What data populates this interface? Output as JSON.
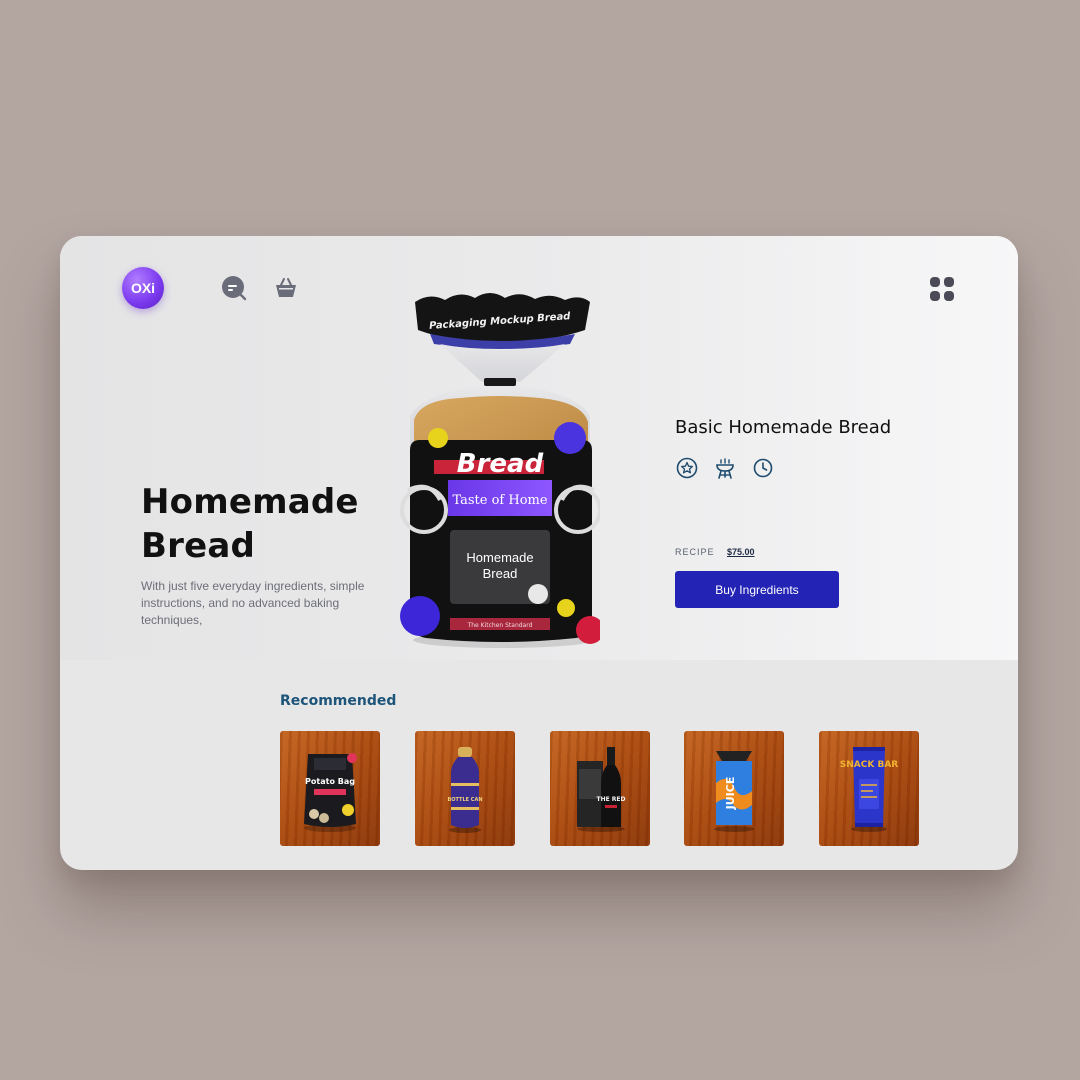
{
  "brand": {
    "logo_text": "OXi"
  },
  "nav": {
    "chat_icon": "search-chat-icon",
    "basket_icon": "basket-icon",
    "menu_icon": "grid-menu-icon"
  },
  "hero": {
    "title_line1": "Homemade",
    "title_line2": "Bread",
    "description": "With just five everyday ingredients, simple instructions, and no advanced baking techniques,"
  },
  "package": {
    "top_text": "Packaging Mockup Bread",
    "brand": "Bread",
    "tagline": "Taste of Home",
    "name_line1": "Homemade",
    "name_line2": "Bread",
    "footer": "The Kitchen Standard"
  },
  "product_detail": {
    "title": "Basic Homemade Bread",
    "icons": [
      "star-icon",
      "grill-icon",
      "clock-icon"
    ],
    "recipe_label": "RECIPE",
    "price": "$75.00",
    "buy_label": "Buy Ingredients"
  },
  "recommended": {
    "title": "Recommended",
    "items": [
      {
        "name": "Potato Bag",
        "label": "Potato Bag"
      },
      {
        "name": "Bottle Can",
        "label": "BOTTLE CAN"
      },
      {
        "name": "The Red",
        "label": "THE RED"
      },
      {
        "name": "Juice",
        "label": "JUICE"
      },
      {
        "name": "Snack Bar",
        "label": "SNACK BAR"
      }
    ]
  },
  "colors": {
    "accent": "#2323b5",
    "logo": "#7d3df0",
    "background": "#b3a6a1",
    "recommended_title": "#1d5479"
  }
}
